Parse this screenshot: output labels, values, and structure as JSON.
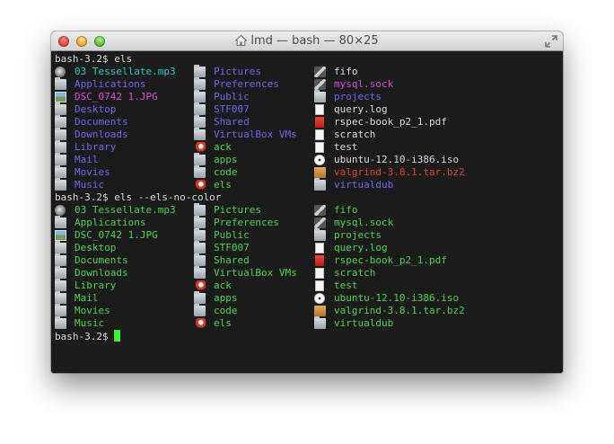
{
  "window": {
    "title": "lmd — bash — 80×25"
  },
  "colors": {
    "normal": "#d9d9d9",
    "dir": "#6f67e8",
    "music": "#2fc7c7",
    "image": "#d54fd5",
    "exec": "#4fd14f",
    "socket": "#d54fd5",
    "archive": "#e0452f",
    "plain": "#4fd14f",
    "cursor": "#3af03a"
  },
  "session": [
    {
      "prompt": "bash-3.2$ els",
      "colored": true,
      "columns": [
        [
          {
            "name": "03 Tessellate.mp3",
            "icon": "music-icon",
            "kind": "music"
          },
          {
            "name": "Applications",
            "icon": "folder-icon",
            "kind": "dir"
          },
          {
            "name": "DSC_0742 1.JPG",
            "icon": "image-icon",
            "kind": "image"
          },
          {
            "name": "Desktop",
            "icon": "folder-icon",
            "kind": "dir"
          },
          {
            "name": "Documents",
            "icon": "folder-icon",
            "kind": "dir"
          },
          {
            "name": "Downloads",
            "icon": "folder-icon",
            "kind": "dir"
          },
          {
            "name": "Library",
            "icon": "folder-icon",
            "kind": "dir"
          },
          {
            "name": "Mail",
            "icon": "folder-icon",
            "kind": "dir"
          },
          {
            "name": "Movies",
            "icon": "folder-icon",
            "kind": "dir"
          },
          {
            "name": "Music",
            "icon": "folder-icon",
            "kind": "dir"
          }
        ],
        [
          {
            "name": "Pictures",
            "icon": "folder-icon",
            "kind": "dir"
          },
          {
            "name": "Preferences",
            "icon": "folder-icon",
            "kind": "dir"
          },
          {
            "name": "Public",
            "icon": "folder-icon",
            "kind": "dir"
          },
          {
            "name": "STF007",
            "icon": "folder-icon",
            "kind": "dir"
          },
          {
            "name": "Shared",
            "icon": "folder-icon",
            "kind": "dir"
          },
          {
            "name": "VirtualBox VMs",
            "icon": "folder-icon",
            "kind": "dir"
          },
          {
            "name": "ack",
            "icon": "rocket-icon",
            "kind": "exec"
          },
          {
            "name": "apps",
            "icon": "folder-icon",
            "kind": "exec"
          },
          {
            "name": "code",
            "icon": "folder-icon",
            "kind": "exec"
          },
          {
            "name": "els",
            "icon": "rocket-icon",
            "kind": "exec"
          }
        ],
        [
          {
            "name": "fifo",
            "icon": "fifo-icon",
            "kind": "normal"
          },
          {
            "name": "mysql.sock",
            "icon": "fifo-icon",
            "kind": "socket"
          },
          {
            "name": "projects",
            "icon": "folder-icon",
            "kind": "dir"
          },
          {
            "name": "query.log",
            "icon": "document-icon",
            "kind": "normal"
          },
          {
            "name": "rspec-book_p2_1.pdf",
            "icon": "pdf-icon",
            "kind": "normal"
          },
          {
            "name": "scratch",
            "icon": "document-icon",
            "kind": "normal"
          },
          {
            "name": "test",
            "icon": "document-icon",
            "kind": "normal"
          },
          {
            "name": "ubuntu-12.10-i386.iso",
            "icon": "disc-icon",
            "kind": "normal"
          },
          {
            "name": "valgrind-3.8.1.tar.bz2",
            "icon": "archive-icon",
            "kind": "archive"
          },
          {
            "name": "virtualdub",
            "icon": "folder-icon",
            "kind": "dir"
          }
        ]
      ]
    },
    {
      "prompt": "bash-3.2$ els --els-no-color",
      "colored": false,
      "columns": [
        [
          {
            "name": "03 Tessellate.mp3",
            "icon": "music-icon"
          },
          {
            "name": "Applications",
            "icon": "folder-icon"
          },
          {
            "name": "DSC_0742 1.JPG",
            "icon": "image-icon"
          },
          {
            "name": "Desktop",
            "icon": "folder-icon"
          },
          {
            "name": "Documents",
            "icon": "folder-icon"
          },
          {
            "name": "Downloads",
            "icon": "folder-icon"
          },
          {
            "name": "Library",
            "icon": "folder-icon"
          },
          {
            "name": "Mail",
            "icon": "folder-icon"
          },
          {
            "name": "Movies",
            "icon": "folder-icon"
          },
          {
            "name": "Music",
            "icon": "folder-icon"
          }
        ],
        [
          {
            "name": "Pictures",
            "icon": "folder-icon"
          },
          {
            "name": "Preferences",
            "icon": "folder-icon"
          },
          {
            "name": "Public",
            "icon": "folder-icon"
          },
          {
            "name": "STF007",
            "icon": "folder-icon"
          },
          {
            "name": "Shared",
            "icon": "folder-icon"
          },
          {
            "name": "VirtualBox VMs",
            "icon": "folder-icon"
          },
          {
            "name": "ack",
            "icon": "rocket-icon"
          },
          {
            "name": "apps",
            "icon": "folder-icon"
          },
          {
            "name": "code",
            "icon": "folder-icon"
          },
          {
            "name": "els",
            "icon": "rocket-icon"
          }
        ],
        [
          {
            "name": "fifo",
            "icon": "fifo-icon"
          },
          {
            "name": "mysql.sock",
            "icon": "fifo-icon"
          },
          {
            "name": "projects",
            "icon": "folder-icon"
          },
          {
            "name": "query.log",
            "icon": "document-icon"
          },
          {
            "name": "rspec-book_p2_1.pdf",
            "icon": "pdf-icon"
          },
          {
            "name": "scratch",
            "icon": "document-icon"
          },
          {
            "name": "test",
            "icon": "document-icon"
          },
          {
            "name": "ubuntu-12.10-i386.iso",
            "icon": "disc-icon"
          },
          {
            "name": "valgrind-3.8.1.tar.bz2",
            "icon": "archive-icon"
          },
          {
            "name": "virtualdub",
            "icon": "folder-icon"
          }
        ]
      ]
    }
  ],
  "final_prompt": "bash-3.2$ "
}
